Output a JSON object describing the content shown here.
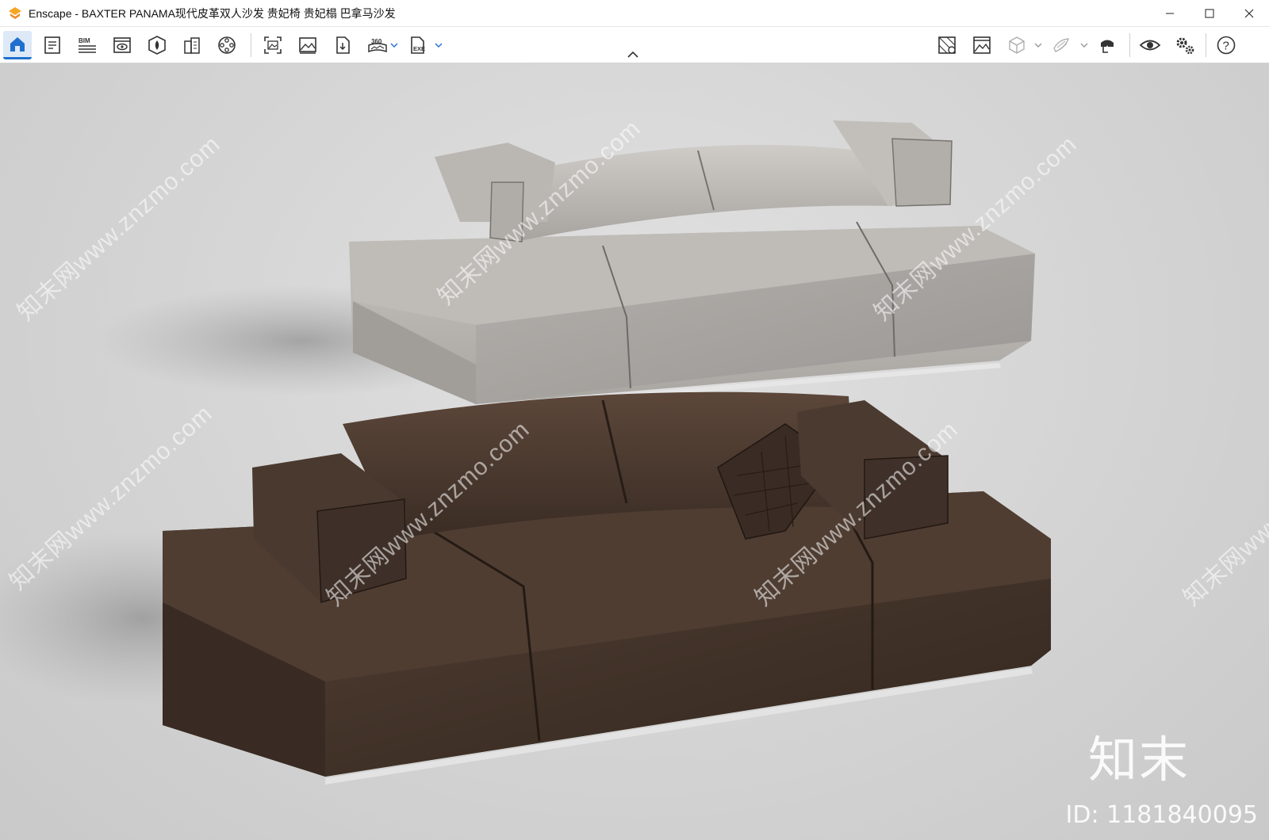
{
  "window": {
    "title": "Enscape - BAXTER PANAMA现代皮革双人沙发 贵妃椅 贵妃榻 巴拿马沙发",
    "accent": "#f5a623"
  },
  "toolbar": {
    "left_icons": [
      "home-icon",
      "sheet-icon",
      "bim-icon",
      "view-icon",
      "asset-icon",
      "building-icon",
      "media-icon",
      "screenshot-icon",
      "image-icon",
      "export-file-icon",
      "panorama-360-icon",
      "exe-export-icon"
    ],
    "bim_label": "BIM",
    "pano_label": "360",
    "exe_label": "EXE",
    "right_icons": [
      "material-icon",
      "render-image-icon",
      "cube-view-icon",
      "section-icon",
      "vr-headset-icon",
      "visibility-icon",
      "settings-icon",
      "help-icon"
    ],
    "help_label": "?"
  },
  "viewport": {
    "watermark_text": "知末网www.znzmo.com",
    "brand_text": "知末",
    "id_text": "ID: 1181840095",
    "sofa_top_color": "#b9b6b2",
    "sofa_bottom_color": "#4a3a30"
  }
}
